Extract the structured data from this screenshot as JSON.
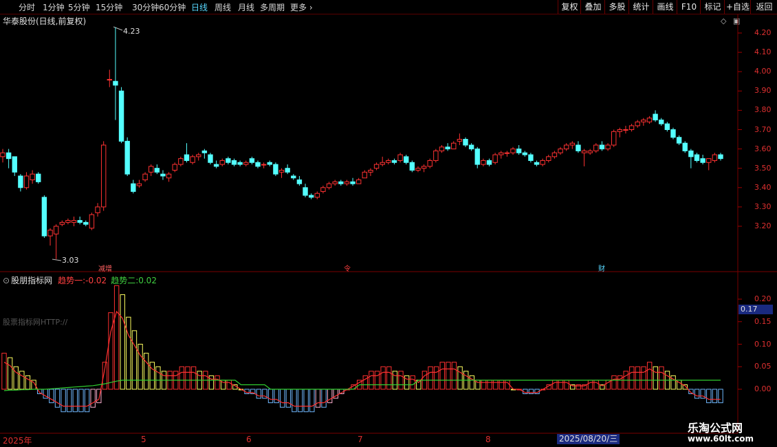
{
  "toolbar": {
    "timeframes": [
      {
        "label": "分时",
        "active": false
      },
      {
        "label": "1分钟",
        "active": false
      },
      {
        "label": "5分钟",
        "active": false
      },
      {
        "label": "15分钟",
        "active": false
      },
      {
        "label": "30分钟",
        "active": false
      },
      {
        "label": "60分钟",
        "active": false
      },
      {
        "label": "日线",
        "active": true
      },
      {
        "label": "周线",
        "active": false
      },
      {
        "label": "月线",
        "active": false
      },
      {
        "label": "多周期",
        "active": false
      },
      {
        "label": "更多 ›",
        "active": false
      }
    ],
    "right_buttons": [
      "复权",
      "叠加",
      "多股",
      "统计",
      "画线",
      "F10",
      "标记",
      "+自选",
      "返回"
    ]
  },
  "main_chart": {
    "title": "华泰股份(日线,前复权)",
    "high_label": "4.23",
    "low_label": "3.03",
    "price_ticks": [
      "4.20",
      "4.10",
      "4.00",
      "3.90",
      "3.80",
      "3.70",
      "3.60",
      "3.50",
      "3.40",
      "3.30",
      "3.20"
    ],
    "event_marks": [
      "减增",
      "令",
      "财"
    ]
  },
  "indicator": {
    "name": "股朋指标网",
    "trend1_label": "趋势一:",
    "trend1_value": "-0.02",
    "trend2_label": "趋势二:",
    "trend2_value": "0.02",
    "watermark": "股票指标网HTTP://",
    "ticks": [
      "0.20",
      "0.15",
      "0.10",
      "0.05",
      "0.00"
    ],
    "current_value": "0.17"
  },
  "date_axis": {
    "year": "2025年",
    "months": [
      "5",
      "6",
      "7",
      "8"
    ],
    "cursor_date": "2025/08/20/三"
  },
  "logo": {
    "line1": "乐淘公式网",
    "line2": "www.60lt.com"
  },
  "colors": {
    "up": "#ff3232",
    "down": "#54ffff",
    "bg": "#000000",
    "grid": "#6a0000",
    "trend1": "#ff3030",
    "trend2": "#30d030"
  },
  "chart_data": [
    {
      "type": "candlestick",
      "title": "华泰股份(日线,前复权)",
      "ylim": [
        3.1,
        4.28
      ],
      "highest": 4.23,
      "lowest": 3.03,
      "ohlc": [
        [
          3.56,
          3.6,
          3.53,
          3.58
        ],
        [
          3.58,
          3.6,
          3.5,
          3.55
        ],
        [
          3.56,
          3.56,
          3.46,
          3.48
        ],
        [
          3.46,
          3.47,
          3.38,
          3.4
        ],
        [
          3.4,
          3.48,
          3.39,
          3.46
        ],
        [
          3.44,
          3.49,
          3.42,
          3.47
        ],
        [
          3.47,
          3.48,
          3.42,
          3.43
        ],
        [
          3.35,
          3.36,
          3.14,
          3.15
        ],
        [
          3.15,
          3.19,
          3.1,
          3.18
        ],
        [
          3.16,
          3.21,
          3.03,
          3.2
        ],
        [
          3.21,
          3.23,
          3.2,
          3.22
        ],
        [
          3.22,
          3.24,
          3.21,
          3.23
        ],
        [
          3.22,
          3.25,
          3.2,
          3.23
        ],
        [
          3.23,
          3.25,
          3.21,
          3.22
        ],
        [
          3.22,
          3.23,
          3.2,
          3.21
        ],
        [
          3.19,
          3.27,
          3.18,
          3.26
        ],
        [
          3.27,
          3.32,
          3.25,
          3.3
        ],
        [
          3.3,
          3.64,
          3.28,
          3.62
        ],
        [
          3.96,
          4.01,
          3.92,
          3.96
        ],
        [
          3.95,
          4.23,
          3.75,
          3.93
        ],
        [
          3.9,
          3.92,
          3.63,
          3.64
        ],
        [
          3.64,
          3.66,
          3.46,
          3.47
        ],
        [
          3.42,
          3.44,
          3.37,
          3.38
        ],
        [
          3.41,
          3.44,
          3.4,
          3.42
        ],
        [
          3.44,
          3.48,
          3.43,
          3.47
        ],
        [
          3.48,
          3.52,
          3.46,
          3.51
        ],
        [
          3.5,
          3.52,
          3.47,
          3.48
        ],
        [
          3.47,
          3.49,
          3.44,
          3.46
        ],
        [
          3.45,
          3.48,
          3.43,
          3.47
        ],
        [
          3.49,
          3.53,
          3.48,
          3.52
        ],
        [
          3.52,
          3.56,
          3.51,
          3.55
        ],
        [
          3.57,
          3.63,
          3.53,
          3.54
        ],
        [
          3.53,
          3.57,
          3.52,
          3.56
        ],
        [
          3.56,
          3.58,
          3.54,
          3.57
        ],
        [
          3.59,
          3.6,
          3.55,
          3.58
        ],
        [
          3.57,
          3.58,
          3.52,
          3.53
        ],
        [
          3.52,
          3.54,
          3.5,
          3.51
        ],
        [
          3.52,
          3.55,
          3.51,
          3.54
        ],
        [
          3.55,
          3.56,
          3.52,
          3.53
        ],
        [
          3.54,
          3.55,
          3.51,
          3.52
        ],
        [
          3.53,
          3.54,
          3.51,
          3.52
        ],
        [
          3.52,
          3.54,
          3.51,
          3.53
        ],
        [
          3.55,
          3.56,
          3.52,
          3.53
        ],
        [
          3.53,
          3.54,
          3.5,
          3.51
        ],
        [
          3.52,
          3.53,
          3.5,
          3.52
        ],
        [
          3.53,
          3.54,
          3.51,
          3.52
        ],
        [
          3.52,
          3.53,
          3.46,
          3.47
        ],
        [
          3.48,
          3.5,
          3.45,
          3.49
        ],
        [
          3.5,
          3.52,
          3.47,
          3.48
        ],
        [
          3.46,
          3.47,
          3.44,
          3.45
        ],
        [
          3.44,
          3.46,
          3.41,
          3.42
        ],
        [
          3.4,
          3.42,
          3.35,
          3.36
        ],
        [
          3.36,
          3.37,
          3.34,
          3.35
        ],
        [
          3.35,
          3.38,
          3.34,
          3.37
        ],
        [
          3.38,
          3.41,
          3.37,
          3.4
        ],
        [
          3.4,
          3.43,
          3.39,
          3.42
        ],
        [
          3.42,
          3.44,
          3.41,
          3.43
        ],
        [
          3.43,
          3.44,
          3.41,
          3.42
        ],
        [
          3.42,
          3.44,
          3.41,
          3.43
        ],
        [
          3.43,
          3.45,
          3.41,
          3.42
        ],
        [
          3.42,
          3.45,
          3.42,
          3.44
        ],
        [
          3.45,
          3.49,
          3.45,
          3.48
        ],
        [
          3.48,
          3.5,
          3.46,
          3.49
        ],
        [
          3.5,
          3.53,
          3.49,
          3.52
        ],
        [
          3.52,
          3.56,
          3.51,
          3.53
        ],
        [
          3.53,
          3.55,
          3.52,
          3.54
        ],
        [
          3.54,
          3.55,
          3.52,
          3.53
        ],
        [
          3.54,
          3.58,
          3.53,
          3.57
        ],
        [
          3.56,
          3.57,
          3.52,
          3.53
        ],
        [
          3.53,
          3.54,
          3.48,
          3.49
        ],
        [
          3.49,
          3.51,
          3.48,
          3.5
        ],
        [
          3.5,
          3.52,
          3.48,
          3.51
        ],
        [
          3.51,
          3.55,
          3.5,
          3.54
        ],
        [
          3.54,
          3.6,
          3.53,
          3.59
        ],
        [
          3.59,
          3.62,
          3.58,
          3.61
        ],
        [
          3.61,
          3.63,
          3.59,
          3.6
        ],
        [
          3.6,
          3.64,
          3.6,
          3.63
        ],
        [
          3.64,
          3.68,
          3.62,
          3.65
        ],
        [
          3.65,
          3.66,
          3.61,
          3.62
        ],
        [
          3.62,
          3.63,
          3.59,
          3.6
        ],
        [
          3.6,
          3.61,
          3.5,
          3.52
        ],
        [
          3.52,
          3.55,
          3.51,
          3.54
        ],
        [
          3.54,
          3.55,
          3.51,
          3.52
        ],
        [
          3.53,
          3.58,
          3.52,
          3.57
        ],
        [
          3.57,
          3.59,
          3.55,
          3.58
        ],
        [
          3.58,
          3.59,
          3.56,
          3.58
        ],
        [
          3.58,
          3.61,
          3.57,
          3.6
        ],
        [
          3.6,
          3.62,
          3.57,
          3.58
        ],
        [
          3.58,
          3.59,
          3.56,
          3.57
        ],
        [
          3.57,
          3.58,
          3.53,
          3.54
        ],
        [
          3.53,
          3.54,
          3.51,
          3.52
        ],
        [
          3.52,
          3.55,
          3.51,
          3.54
        ],
        [
          3.54,
          3.57,
          3.53,
          3.56
        ],
        [
          3.56,
          3.59,
          3.55,
          3.58
        ],
        [
          3.58,
          3.61,
          3.57,
          3.6
        ],
        [
          3.6,
          3.63,
          3.59,
          3.62
        ],
        [
          3.62,
          3.64,
          3.6,
          3.63
        ],
        [
          3.62,
          3.64,
          3.58,
          3.59
        ],
        [
          3.58,
          3.6,
          3.51,
          3.59
        ],
        [
          3.58,
          3.6,
          3.57,
          3.59
        ],
        [
          3.59,
          3.63,
          3.58,
          3.62
        ],
        [
          3.62,
          3.64,
          3.59,
          3.6
        ],
        [
          3.6,
          3.63,
          3.59,
          3.62
        ],
        [
          3.62,
          3.7,
          3.61,
          3.69
        ],
        [
          3.69,
          3.71,
          3.66,
          3.7
        ],
        [
          3.7,
          3.72,
          3.68,
          3.7
        ],
        [
          3.7,
          3.73,
          3.69,
          3.72
        ],
        [
          3.72,
          3.75,
          3.71,
          3.74
        ],
        [
          3.74,
          3.76,
          3.72,
          3.75
        ],
        [
          3.74,
          3.77,
          3.73,
          3.76
        ],
        [
          3.78,
          3.8,
          3.74,
          3.75
        ],
        [
          3.75,
          3.76,
          3.72,
          3.73
        ],
        [
          3.73,
          3.74,
          3.69,
          3.7
        ],
        [
          3.7,
          3.71,
          3.65,
          3.66
        ],
        [
          3.66,
          3.67,
          3.62,
          3.63
        ],
        [
          3.63,
          3.64,
          3.58,
          3.59
        ],
        [
          3.59,
          3.6,
          3.5,
          3.56
        ],
        [
          3.57,
          3.58,
          3.53,
          3.54
        ],
        [
          3.55,
          3.57,
          3.52,
          3.53
        ],
        [
          3.53,
          3.54,
          3.49,
          3.55
        ],
        [
          3.54,
          3.58,
          3.53,
          3.57
        ],
        [
          3.57,
          3.58,
          3.54,
          3.55
        ]
      ]
    },
    {
      "type": "bar",
      "title": "股朋指标网",
      "ylim": [
        -0.055,
        0.23
      ],
      "series": [
        {
          "name": "趋势一",
          "values": [
            0.08,
            0.07,
            0.05,
            0.04,
            0.03,
            0.02,
            -0.01,
            -0.02,
            -0.03,
            -0.04,
            -0.05,
            -0.05,
            -0.05,
            -0.05,
            -0.05,
            -0.04,
            -0.03,
            0.06,
            0.17,
            0.23,
            0.21,
            0.16,
            0.13,
            0.1,
            0.08,
            0.06,
            0.05,
            0.04,
            0.04,
            0.04,
            0.05,
            0.05,
            0.05,
            0.04,
            0.04,
            0.03,
            0.03,
            0.02,
            0.02,
            0.01,
            0.0,
            -0.01,
            -0.01,
            -0.02,
            -0.02,
            -0.03,
            -0.03,
            -0.04,
            -0.04,
            -0.05,
            -0.05,
            -0.05,
            -0.05,
            -0.04,
            -0.04,
            -0.03,
            -0.02,
            -0.01,
            0.0,
            0.01,
            0.02,
            0.03,
            0.04,
            0.04,
            0.05,
            0.05,
            0.04,
            0.04,
            0.03,
            0.03,
            0.02,
            0.04,
            0.05,
            0.05,
            0.06,
            0.06,
            0.06,
            0.05,
            0.04,
            0.03,
            0.02,
            0.02,
            0.02,
            0.02,
            0.02,
            0.02,
            0.0,
            0.0,
            -0.01,
            -0.01,
            -0.01,
            0.0,
            0.01,
            0.02,
            0.02,
            0.02,
            0.01,
            0.01,
            0.01,
            0.02,
            0.02,
            0.01,
            0.02,
            0.03,
            0.03,
            0.04,
            0.05,
            0.05,
            0.05,
            0.06,
            0.05,
            0.05,
            0.04,
            0.03,
            0.02,
            0.01,
            -0.01,
            -0.02,
            -0.02,
            -0.03,
            -0.03,
            -0.03
          ]
        },
        {
          "name": "趋势二",
          "values": [
            -0.003,
            -0.002,
            -0.002,
            -0.001,
            -0.001,
            0.0,
            0.0,
            0.0,
            0.001,
            0.002,
            0.003,
            0.004,
            0.005,
            0.006,
            0.007,
            0.008,
            0.01,
            0.012,
            0.015,
            0.018,
            0.02,
            0.02,
            0.02,
            0.02,
            0.02,
            0.02,
            0.02,
            0.02,
            0.02,
            0.02,
            0.02,
            0.02,
            0.02,
            0.02,
            0.02,
            0.02,
            0.02,
            0.02,
            0.02,
            0.02,
            0.01,
            0.01,
            0.01,
            0.01,
            0.01,
            0.0,
            0.0,
            0.0,
            0.0,
            0.0,
            0.0,
            0.0,
            0.0,
            0.0,
            0.0,
            0.0,
            0.0,
            0.0,
            0.0,
            0.0,
            0.01,
            0.01,
            0.01,
            0.01,
            0.01,
            0.01,
            0.01,
            0.01,
            0.01,
            0.01,
            0.02,
            0.02,
            0.02,
            0.02,
            0.02,
            0.02,
            0.02,
            0.02,
            0.02,
            0.02,
            0.02,
            0.02,
            0.02,
            0.02,
            0.02,
            0.02,
            0.02,
            0.02,
            0.02,
            0.02,
            0.02,
            0.02,
            0.02,
            0.02,
            0.02,
            0.02,
            0.02,
            0.02,
            0.02,
            0.02,
            0.02,
            0.02,
            0.02,
            0.02,
            0.02,
            0.02,
            0.02,
            0.02,
            0.02,
            0.02,
            0.02,
            0.02,
            0.02,
            0.02,
            0.02,
            0.02,
            0.02,
            0.02,
            0.02,
            0.02,
            0.02,
            0.02
          ]
        }
      ]
    }
  ]
}
